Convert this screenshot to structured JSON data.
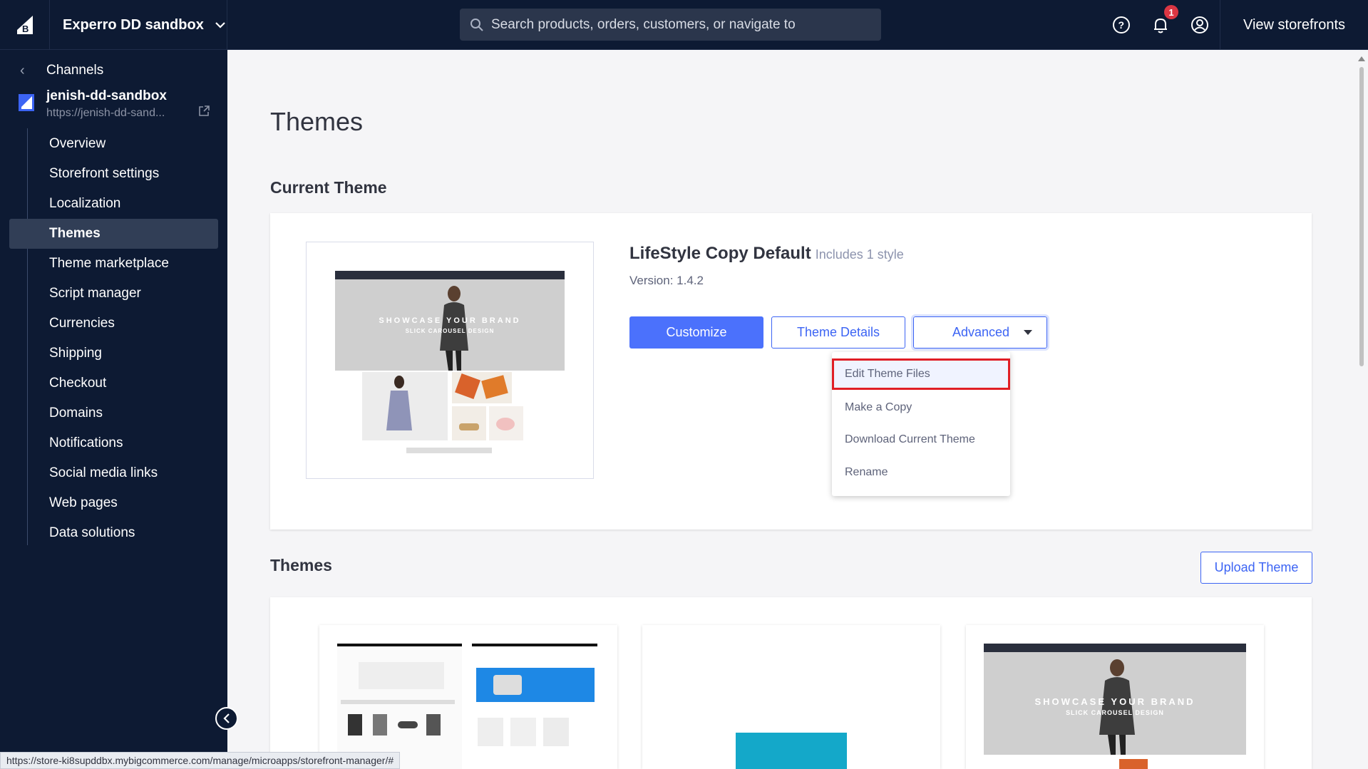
{
  "topbar": {
    "store_name": "Experro DD sandbox",
    "search_placeholder": "Search products, orders, customers, or navigate to",
    "notification_count": "1",
    "view_storefronts": "View storefronts"
  },
  "sidebar": {
    "back_label": "Channels",
    "channel_name": "jenish-dd-sandbox",
    "channel_url": "https://jenish-dd-sand...",
    "items": [
      {
        "label": "Overview",
        "active": false
      },
      {
        "label": "Storefront settings",
        "active": false
      },
      {
        "label": "Localization",
        "active": false
      },
      {
        "label": "Themes",
        "active": true
      },
      {
        "label": "Theme marketplace",
        "active": false
      },
      {
        "label": "Script manager",
        "active": false
      },
      {
        "label": "Currencies",
        "active": false
      },
      {
        "label": "Shipping",
        "active": false
      },
      {
        "label": "Checkout",
        "active": false
      },
      {
        "label": "Domains",
        "active": false
      },
      {
        "label": "Notifications",
        "active": false
      },
      {
        "label": "Social media links",
        "active": false
      },
      {
        "label": "Web pages",
        "active": false
      },
      {
        "label": "Data solutions",
        "active": false
      }
    ]
  },
  "main": {
    "page_title": "Themes",
    "current_theme_title": "Current Theme",
    "theme_name": "LifeStyle Copy Default",
    "theme_styles": "Includes 1 style",
    "theme_version": "Version: 1.4.2",
    "customize_label": "Customize",
    "theme_details_label": "Theme Details",
    "advanced_label": "Advanced",
    "advanced_menu": [
      "Edit Theme Files",
      "Make a Copy",
      "Download Current Theme",
      "Rename"
    ],
    "themes_title": "Themes",
    "upload_label": "Upload Theme",
    "thumb_hero_text": "SHOWCASE YOUR BRAND",
    "thumb_hero_sub": "SLICK CAROUSEL DESIGN"
  },
  "status_url": "https://store-ki8supddbx.mybigcommerce.com/manage/microapps/storefront-manager/#",
  "colors": {
    "nav_bg": "#0d1a33",
    "primary": "#4b71fc",
    "link": "#3c64f4",
    "highlight_border": "#e01e25",
    "badge": "#db3643"
  }
}
